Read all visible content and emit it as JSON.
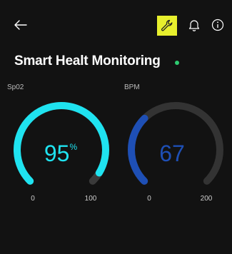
{
  "header": {
    "back_icon": "arrow-left-icon",
    "settings_icon": "wrench-icon",
    "notification_icon": "bell-icon",
    "info_icon": "info-icon",
    "accent_color": "#e7ef2d"
  },
  "page": {
    "title": "Smart Healt Monitoring",
    "status_color": "#2ecc71"
  },
  "gauges": {
    "spo2": {
      "label": "Sp02",
      "value": "95",
      "unit": "%",
      "min": "0",
      "max": "100",
      "level": 0.95,
      "color": "#1fe3f0"
    },
    "bpm": {
      "label": "BPM",
      "value": "67",
      "unit": "",
      "min": "0",
      "max": "200",
      "level": 0.335,
      "color": "#1e4fb5"
    }
  }
}
